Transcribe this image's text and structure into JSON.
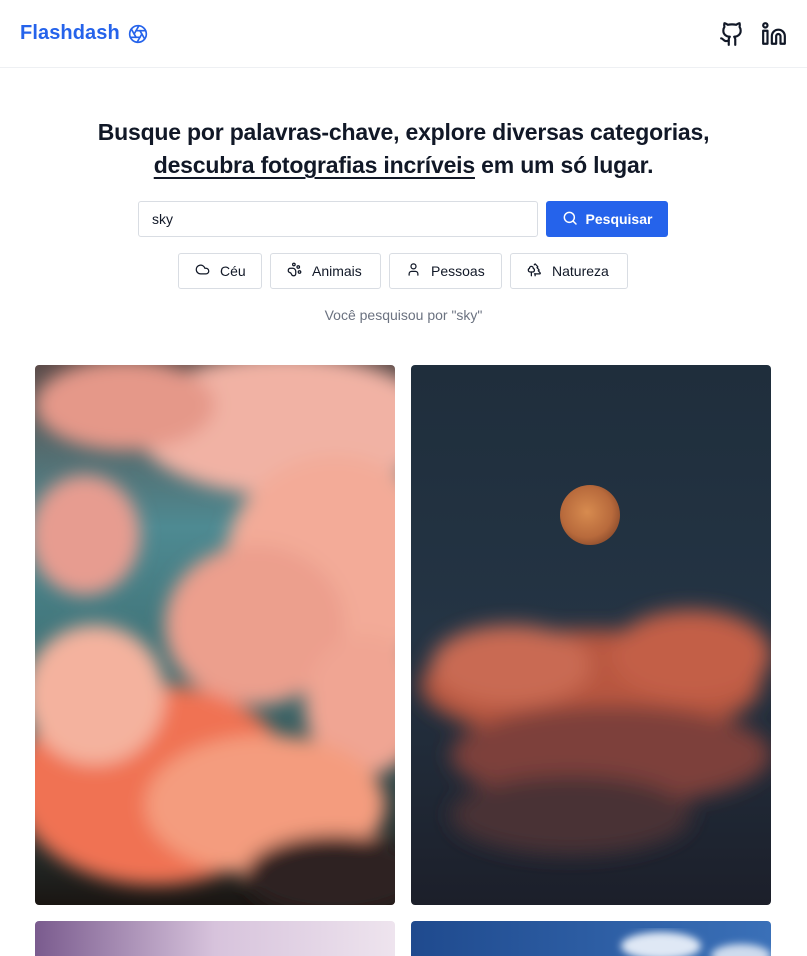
{
  "header": {
    "brand": "Flashdash",
    "icons": [
      "aperture-icon",
      "github-icon",
      "linkedin-icon"
    ]
  },
  "hero": {
    "line1": "Busque por palavras-chave, explore diversas categorias,",
    "line2_underlined": "descubra fotografias incríveis",
    "line2_rest": " em um só lugar."
  },
  "search": {
    "value": "sky",
    "button_label": "Pesquisar"
  },
  "categories": [
    {
      "label": "Céu",
      "icon": "cloud-icon"
    },
    {
      "label": "Animais",
      "icon": "paw-icon"
    },
    {
      "label": "Pessoas",
      "icon": "user-icon"
    },
    {
      "label": "Natureza",
      "icon": "trees-icon"
    }
  ],
  "result_note": "Você pesquisou por \"sky\"",
  "colors": {
    "accent": "#2563eb",
    "text": "#111827",
    "muted": "#6b7280",
    "border": "#d9dde3"
  }
}
